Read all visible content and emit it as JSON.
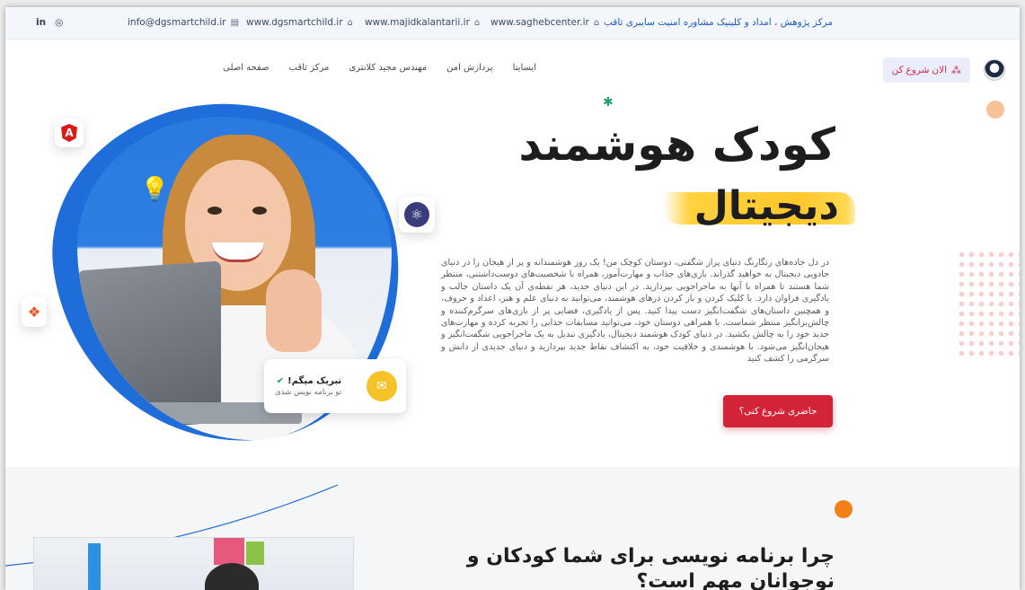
{
  "topbar": {
    "social": [
      "in",
      "◎"
    ],
    "email": "info@dgsmartchild.ir",
    "site1": "www.dgsmartchild.ir",
    "site2": "www.majidkalantarii.ir",
    "site3": "www.saghebcenter.ir",
    "company": "مرکز پژوهش ، امداد و کلینیک مشاوره امنیت سایبری ثاقب"
  },
  "header": {
    "start_button": "الان شروع کن",
    "nav": [
      "صفحه اصلی",
      "مرکز ثاقب",
      "مهندس مجید کلانتری",
      "پردازش امن",
      "ایساینا"
    ]
  },
  "hero": {
    "title": "کودک هوشمند",
    "subtitle": "دیجیتال",
    "description": "در دل جاده‌های رنگارنگ دنیای پراز شگفتی، دوستان کوچک من! یک روز هوشمندانه و پر از هیجان را در دنیای جادویی دیجیتال به خواهید گذراند. بازی‌های جذاب و مهارت‌آموز، همراه با شخصیت‌های دوست‌داشتنی، منتظر شما هستند تا همراه با آنها به ماجراجویی بپردازید. در این دنیای جدید، هر نقطه‌ی آن یک داستان جالب و یادگیری فراوان دارد. با کلیک کردن و باز کردن درهای هوشمند، می‌توانید به دنیای علم و هنر، اعداد و حروف، و همچنین داستان‌های شگفت‌انگیز دست پیدا کنید. پس از یادگیری، فضایی پر از بازی‌های سرگرم‌کننده و چالش‌برانگیز منتظر شماست. با همراهی دوستان خود، می‌توانید مسابقات جذابی را تجربه کرده و مهارت‌های جدید خود را به چالش بکشید. در دنیای کودک هوشمند دیجیتال، یادگیری تبدیل به یک ماجراجویی شگفت‌انگیز و هیجان‌انگیز می‌شود. با هوشمندی و خلاقیت خود، به اکتشاف نقاط جدید بپردازید و دنیای جدیدی از دانش و سرگرمی را کشف کنید",
    "cta": "حاضری شروع کنی؟",
    "card_title": "تبریک میگم!",
    "card_sub": "تو برنامه نویس شدی"
  },
  "section2": {
    "title": "چرا برنامه نویسی برای شما کودکان و نوجوانان مهم است؟"
  },
  "icons": {
    "angular": "angular-icon",
    "atom": "react-icon",
    "figma": "figma-icon",
    "mail": "mail-icon",
    "bulb": "lightbulb-icon"
  },
  "colors": {
    "accent_red": "#d22436",
    "link_blue": "#1e5bbf",
    "blob_blue": "#1e6dd8",
    "highlight_yellow": "#ffc72b",
    "dot_orange": "#f57f17"
  }
}
